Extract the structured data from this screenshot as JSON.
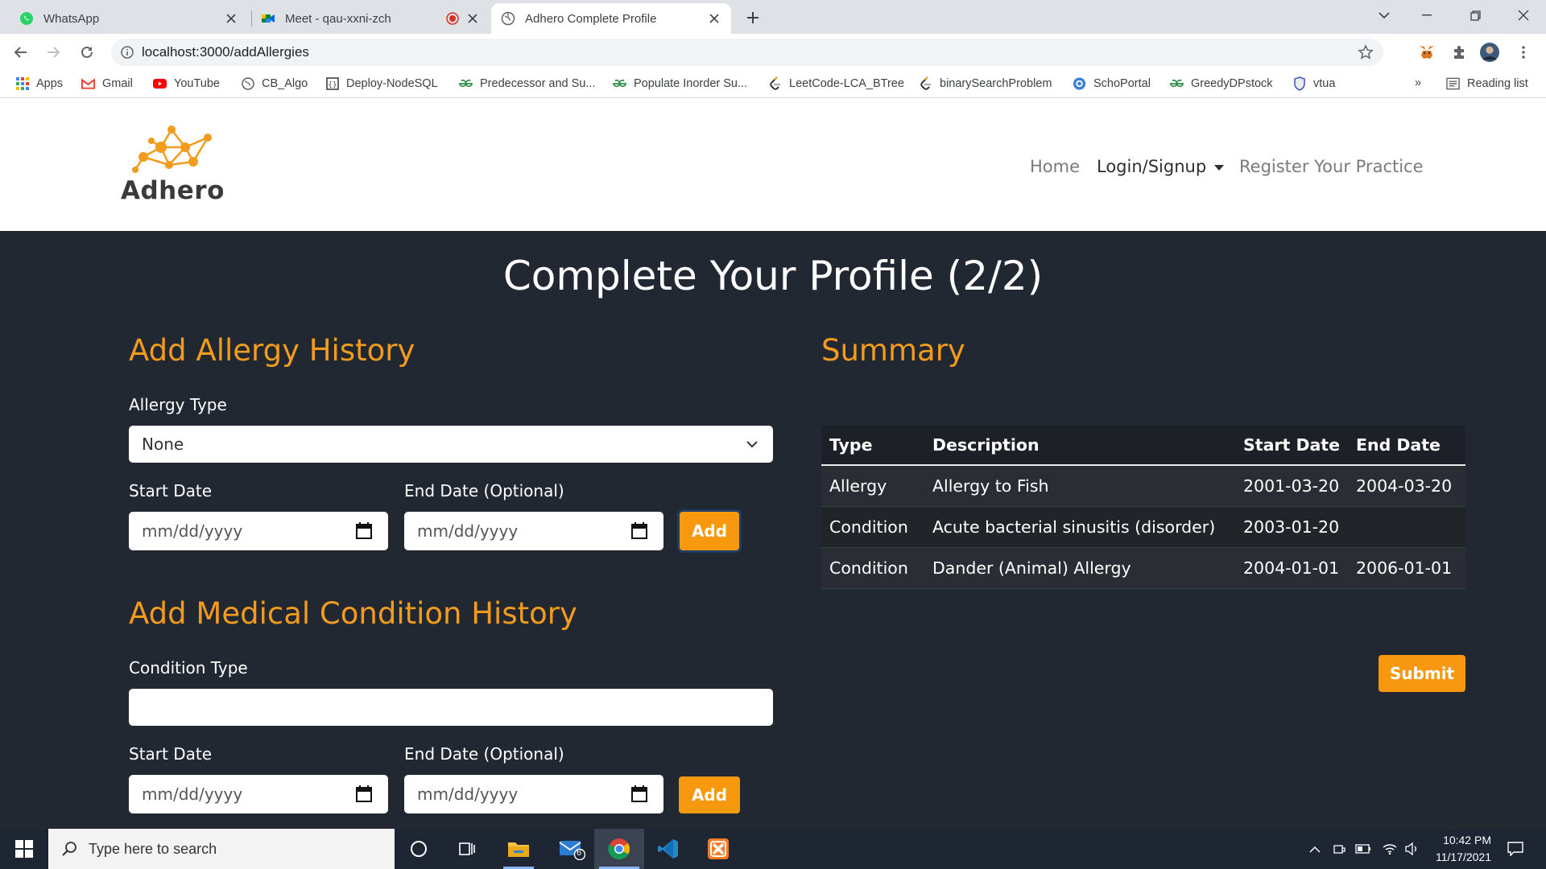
{
  "browser": {
    "tabs": [
      {
        "title": "WhatsApp",
        "icon": "whatsapp-icon",
        "active": false
      },
      {
        "title": "Meet - qau-xxni-zch",
        "icon": "meet-icon",
        "active": false
      },
      {
        "title": "Adhero Complete Profile",
        "icon": "globe-icon",
        "active": true
      }
    ],
    "url": "localhost:3000/addAllergies",
    "bookmarks": [
      {
        "label": "Apps",
        "icon": "apps-grid-icon"
      },
      {
        "label": "Gmail",
        "icon": "gmail-icon"
      },
      {
        "label": "YouTube",
        "icon": "youtube-icon"
      },
      {
        "label": "CB_Algo",
        "icon": "globe-icon"
      },
      {
        "label": "Deploy-NodeSQL",
        "icon": "code-icon"
      },
      {
        "label": "Predecessor and Su...",
        "icon": "gfg-icon"
      },
      {
        "label": "Populate Inorder Su...",
        "icon": "gfg-icon"
      },
      {
        "label": "LeetCode-LCA_BTree",
        "icon": "leetcode-icon"
      },
      {
        "label": "binarySearchProblem",
        "icon": "leetcode-icon"
      },
      {
        "label": "SchoPortal",
        "icon": "portal-icon"
      },
      {
        "label": "GreedyDPstock",
        "icon": "gfg-icon"
      },
      {
        "label": "vtua",
        "icon": "shield-icon"
      }
    ],
    "more_bookmarks": "»",
    "reading_list": "Reading list"
  },
  "site": {
    "logo_text": "Adhero",
    "nav": {
      "home": "Home",
      "login": "Login/Signup",
      "register": "Register Your Practice"
    }
  },
  "page": {
    "title": "Complete Your Profile (2/2)",
    "allergy": {
      "heading": "Add Allergy History",
      "type_label": "Allergy Type",
      "type_value": "None",
      "start_label": "Start Date",
      "end_label": "End Date (Optional)",
      "start_placeholder": "mm/dd/yyyy",
      "end_placeholder": "mm/dd/yyyy",
      "add_label": "Add"
    },
    "condition": {
      "heading": "Add Medical Condition History",
      "type_label": "Condition Type",
      "type_value": "",
      "start_label": "Start Date",
      "end_label": "End Date (Optional)",
      "start_placeholder": "mm/dd/yyyy",
      "end_placeholder": "mm/dd/yyyy",
      "add_label": "Add"
    },
    "summary": {
      "heading": "Summary",
      "columns": [
        "Type",
        "Description",
        "Start Date",
        "End Date"
      ],
      "rows": [
        [
          "Allergy",
          "Allergy to Fish",
          "2001-03-20",
          "2004-03-20"
        ],
        [
          "Condition",
          "Acute bacterial sinusitis (disorder)",
          "2003-01-20",
          ""
        ],
        [
          "Condition",
          "Dander (Animal) Allergy",
          "2004-01-01",
          "2006-01-01"
        ]
      ],
      "submit_label": "Submit"
    }
  },
  "taskbar": {
    "search_placeholder": "Type here to search",
    "mail_badge": "6",
    "time": "10:42 PM",
    "date": "11/17/2021"
  },
  "colors": {
    "accent": "#f7980f",
    "heading_orange": "#f29b1d",
    "dark_bg": "#222831"
  }
}
